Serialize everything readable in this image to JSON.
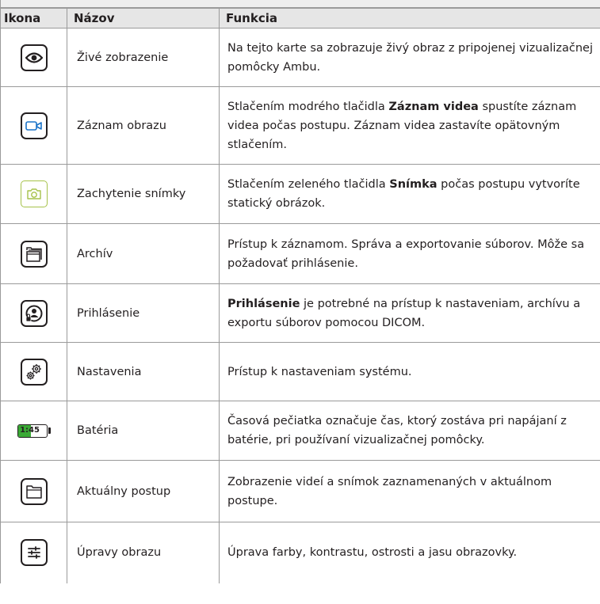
{
  "header": {
    "col_icon": "Ikona",
    "col_name": "Názov",
    "col_function": "Funkcia"
  },
  "rows": [
    {
      "icon": "eye-icon",
      "name": "Živé zobrazenie",
      "func_pre": "Na tejto karte sa zobrazuje živý obraz z pripojenej vizualizačnej pomôcky Ambu.",
      "func_bold": "",
      "func_post": ""
    },
    {
      "icon": "video-camera-icon",
      "name": "Záznam obrazu",
      "func_pre": "Stlačením modrého tlačidla ",
      "func_bold": "Záznam videa",
      "func_post": " spustíte záznam videa počas postupu. Záznam videa zastavíte opätovným stlačením."
    },
    {
      "icon": "photo-camera-icon",
      "name": "Zachytenie snímky",
      "func_pre": "Stlačením zeleného tlačidla ",
      "func_bold": "Snímka",
      "func_post": " počas postupu vytvoríte statický obrázok."
    },
    {
      "icon": "archive-icon",
      "name": "Archív",
      "func_pre": "Prístup k záznamom. Správa a exportovanie súborov. Môže sa požadovať prihlásenie.",
      "func_bold": "",
      "func_post": ""
    },
    {
      "icon": "login-user-icon",
      "name": "Prihlásenie",
      "func_pre": "",
      "func_bold": "Prihlásenie",
      "func_post": " je potrebné na prístup k nastaveniam, archívu a exportu súborov pomocou DICOM."
    },
    {
      "icon": "settings-gears-icon",
      "name": "Nastavenia",
      "func_pre": "Prístup k nastaveniam systému.",
      "func_bold": "",
      "func_post": ""
    },
    {
      "icon": "battery-icon",
      "name": "Batéria",
      "func_pre": "Časová pečiatka označuje čas, ktorý zostáva pri napájaní z batérie, pri používaní vizualizačnej pomôcky.",
      "func_bold": "",
      "func_post": ""
    },
    {
      "icon": "folder-icon",
      "name": "Aktuálny postup",
      "func_pre": "Zobrazenie videí a snímok zaznamenaných v aktuálnom postupe.",
      "func_bold": "",
      "func_post": ""
    },
    {
      "icon": "image-adjust-sliders-icon",
      "name": "Úpravy obrazu",
      "func_pre": "Úprava farby, kontrastu, ostrosti a jasu obrazovky.",
      "func_bold": "",
      "func_post": ""
    }
  ],
  "battery": {
    "label": "1:45",
    "fill_fraction": 0.45,
    "fill_color": "#3aa935"
  },
  "colors": {
    "video_icon": "#1a73c8",
    "snapshot_icon": "#a6c24a",
    "border": "#9a9a9a",
    "header_bg": "#e6e6e6"
  }
}
